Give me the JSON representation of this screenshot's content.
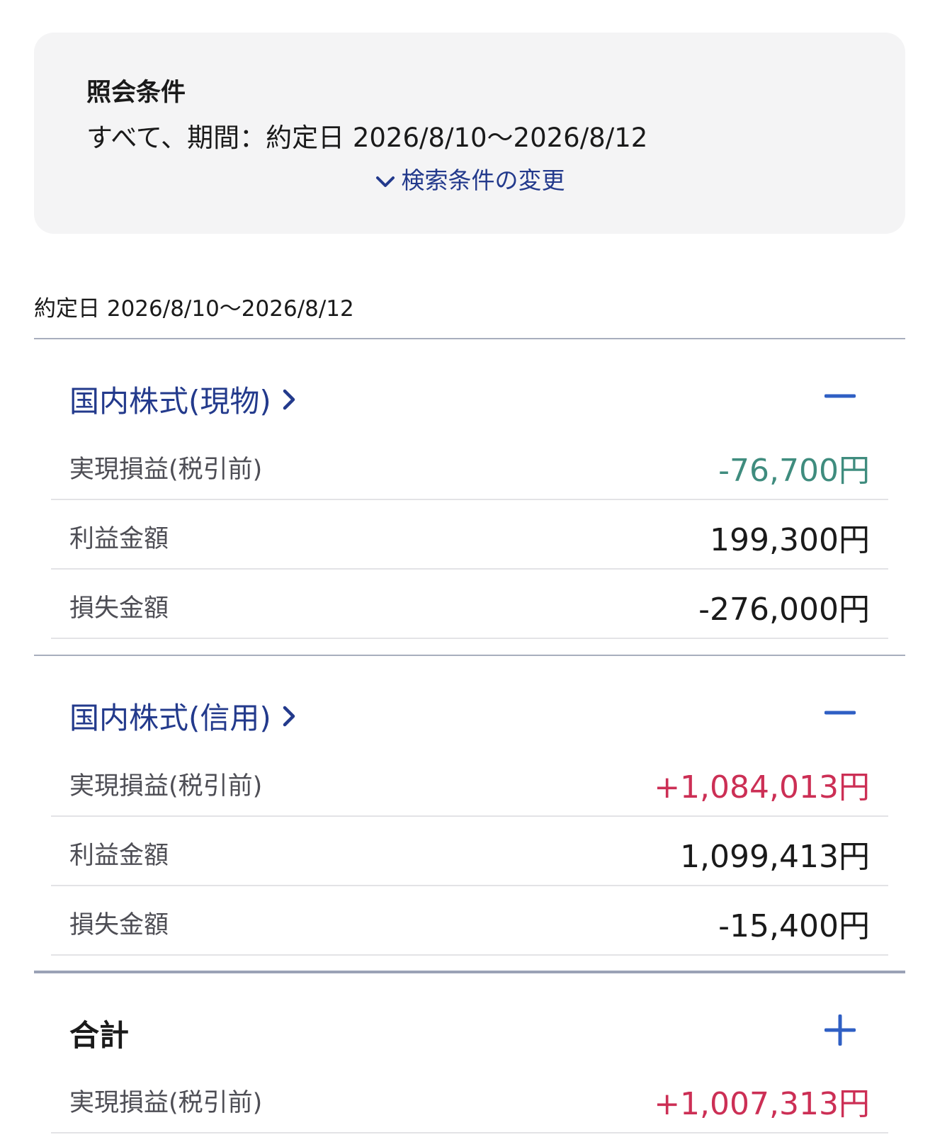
{
  "conditions": {
    "title": "照会条件",
    "text": "すべて、期間：約定日 2026/8/10〜2026/8/12",
    "change_label": "検索条件の変更"
  },
  "period": "約定日 2026/8/10〜2026/8/12",
  "sections": [
    {
      "title": "国内株式(現物)",
      "toggle": "collapse",
      "rows": [
        {
          "label": "実現損益(税引前)",
          "value": "-76,700円"
        },
        {
          "label": "利益金額",
          "value": "199,300円"
        },
        {
          "label": "損失金額",
          "value": "-276,000円"
        }
      ]
    },
    {
      "title": "国内株式(信用)",
      "toggle": "collapse",
      "rows": [
        {
          "label": "実現損益(税引前)",
          "value": "+1,084,013円"
        },
        {
          "label": "利益金額",
          "value": "1,099,413円"
        },
        {
          "label": "損失金額",
          "value": "-15,400円"
        }
      ]
    }
  ],
  "total": {
    "title": "合計",
    "toggle": "expand",
    "rows": [
      {
        "label": "実現損益(税引前)",
        "value": "+1,007,313円"
      }
    ]
  },
  "colors": {
    "accent": "#233a8c",
    "loss": "#3f8c7e",
    "gain": "#cc2f55",
    "toggle_blue": "#2f5fc4"
  }
}
